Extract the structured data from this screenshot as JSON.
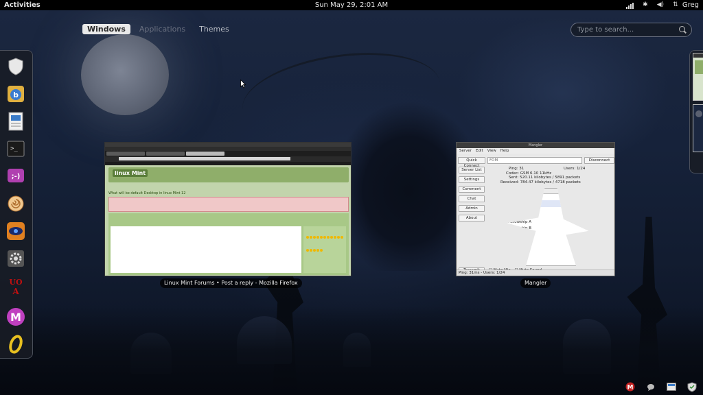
{
  "topbar": {
    "activities": "Activities",
    "clock": "Sun May 29,  2:01 AM",
    "user": "Greg"
  },
  "overview": {
    "tabs": [
      {
        "label": "Windows",
        "active": true
      },
      {
        "label": "Applications",
        "active": false
      },
      {
        "label": "Themes",
        "active": false
      }
    ],
    "search_placeholder": "Type to search..."
  },
  "dash": {
    "items": [
      {
        "icon": "shield-icon",
        "color": "#e8e8e8"
      },
      {
        "icon": "blue-b-app-icon",
        "color": "#4a90d0"
      },
      {
        "icon": "document-viewer-icon",
        "color": "#3a7bc8"
      },
      {
        "icon": "terminal-icon",
        "color": "#1a1a1a"
      },
      {
        "icon": "chat-smiley-icon",
        "color": "#b040b0"
      },
      {
        "icon": "spiral-shell-icon",
        "color": "#e0a060"
      },
      {
        "icon": "eye-icon",
        "color": "#e08020"
      },
      {
        "icon": "settings-gear-icon",
        "color": "#808080"
      },
      {
        "icon": "uoa-icon",
        "color": "#c01010"
      },
      {
        "icon": "mangler-m-icon",
        "color": "#c040c0"
      },
      {
        "icon": "gold-ring-icon",
        "color": "#e8c020"
      }
    ]
  },
  "windows": {
    "firefox": {
      "label": "Linux Mint Forums • Post a reply - Mozilla Firefox",
      "page_logo": "linux Mint",
      "heading": "What will be default Desktop in linux Mint 12"
    },
    "mangler": {
      "label": "Mangler",
      "title": "Mangler",
      "menu": [
        "Server",
        "Edit",
        "View",
        "Help"
      ],
      "quick_connect": "Quick Connect",
      "server_field": "FOM",
      "disconnect": "Disconnect",
      "side_buttons": [
        "Server List",
        "Settings",
        "Comment",
        "Chat",
        "Admin",
        "About"
      ],
      "stats": {
        "ping": "Ping: 31",
        "users": "Users: 1/24",
        "codec": "Codec: GSM 6.10 11kHz",
        "sent": "Sent: 520.11 kilobytes / 5891 packets",
        "received": "Received: 784.47 kilobytes / 4718 packets"
      },
      "tree_headers": {
        "name": "Name",
        "last": "Last Transmit"
      },
      "tree": [
        {
          "label": "Foes of Mordor (ADMIN)",
          "indent": 0,
          "time": ""
        },
        {
          "label": "[A] WavyGravy",
          "indent": 1,
          "time": "00:34:34"
        },
        {
          "label": "Alliance Channel",
          "indent": 1,
          "time": ""
        },
        {
          "label": "Grouping",
          "indent": 1,
          "time": ""
        },
        {
          "label": "Fellowship A",
          "indent": 2,
          "time": ""
        },
        {
          "label": "Fellowship B",
          "indent": 2,
          "time": ""
        },
        {
          "label": "Raid A",
          "indent": 2,
          "time": ""
        },
        {
          "label": "Raid B",
          "indent": 2,
          "time": ""
        },
        {
          "label": "Skirmish B",
          "indent": 2,
          "time": ""
        },
        {
          "label": "Skirmish A",
          "indent": 2,
          "time": ""
        },
        {
          "label": "Monster Play",
          "indent": 1,
          "time": ""
        }
      ],
      "transmit": "Transmit",
      "mute_mic": "Mute Mic",
      "mute_sound": "Mute Sound",
      "status": "Ping: 31ms - Users: 1/24"
    }
  },
  "colors": {
    "topbar": "#000000",
    "accent_active_tab": "#e9e9e9"
  }
}
